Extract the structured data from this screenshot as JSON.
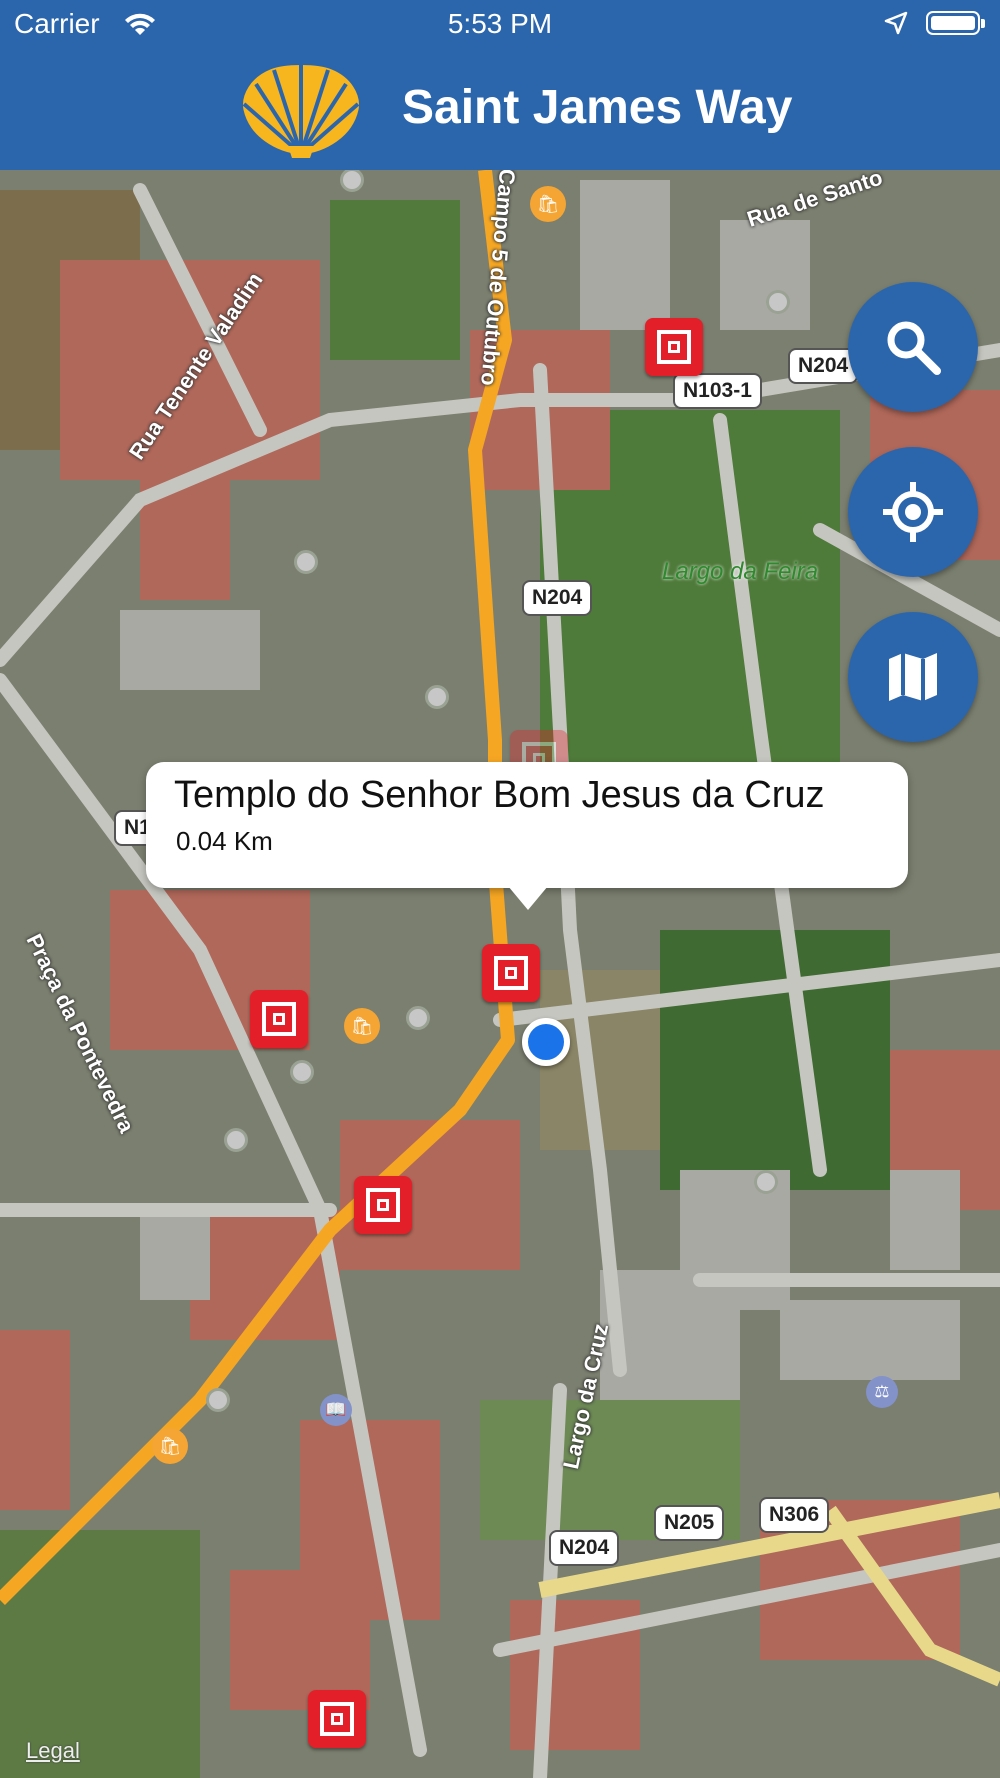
{
  "status_bar": {
    "carrier": "Carrier",
    "time": "5:53 PM"
  },
  "header": {
    "title": "Saint James Way",
    "logo_icon": "scallop-shell-icon"
  },
  "map": {
    "road_labels": [
      "N204",
      "N103-1",
      "N204",
      "N103-1",
      "N205",
      "N306",
      "N204"
    ],
    "street_labels": [
      "Rua Tenente Valadim",
      "Campo 5 de Outubro",
      "Rua de Santo",
      "Praça da Pontevedra",
      "Largo da Cruz"
    ],
    "area_labels": [
      "Largo da Feira"
    ],
    "legal": "Legal"
  },
  "callout": {
    "name": "Templo do Senhor Bom Jesus da Cruz",
    "distance": "0.04 Km"
  },
  "buttons": {
    "search_icon": "search-icon",
    "locate_icon": "crosshair-icon",
    "map_icon": "map-icon"
  },
  "colors": {
    "header": "#2b66ad",
    "route": "#f5a623",
    "poi": "#e3202a",
    "user_location": "#1a73e8"
  }
}
